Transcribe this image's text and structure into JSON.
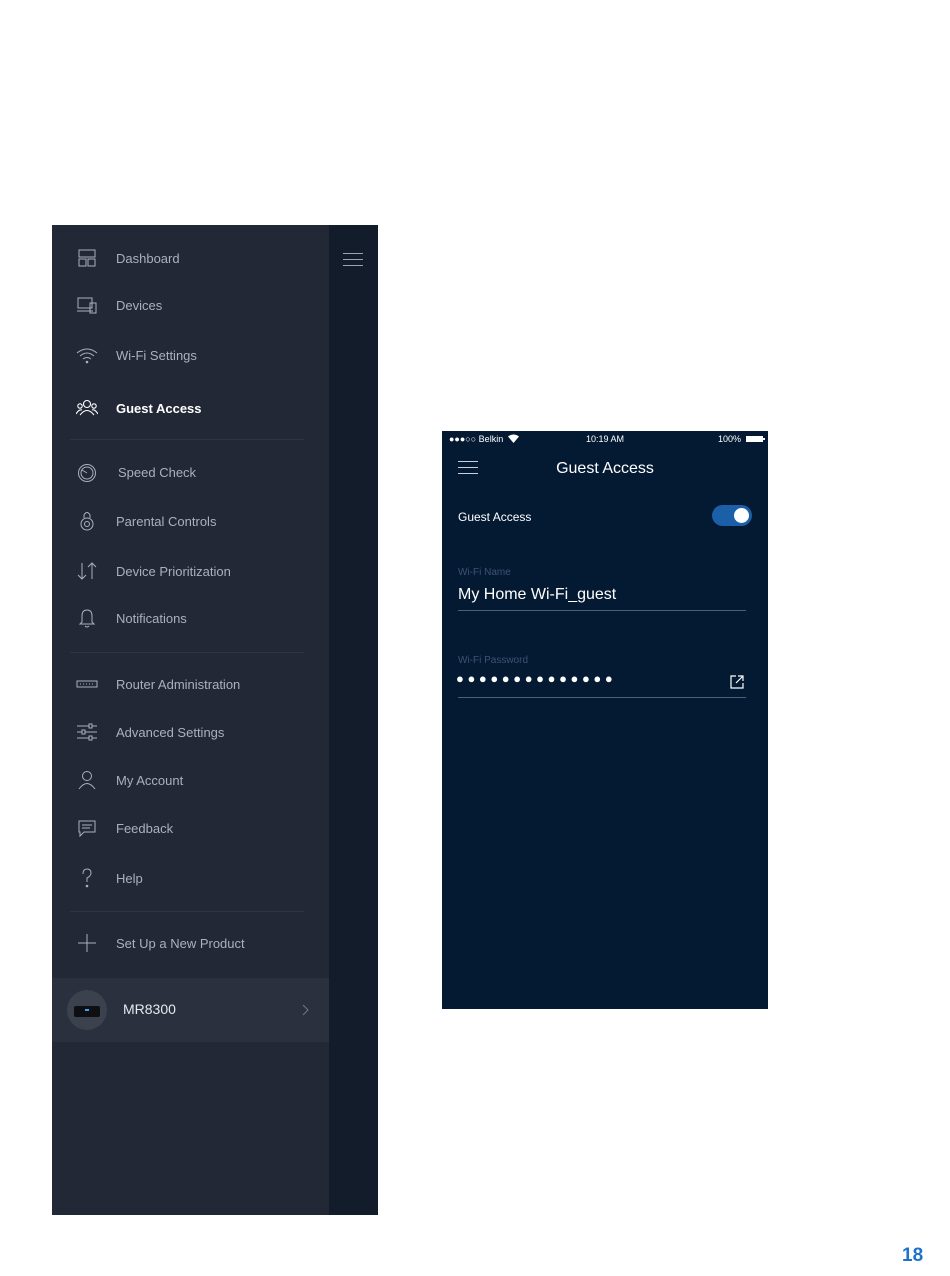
{
  "menu": {
    "items": [
      {
        "label": "Dashboard",
        "icon": "dashboard-icon"
      },
      {
        "label": "Devices",
        "icon": "devices-icon"
      },
      {
        "label": "Wi-Fi Settings",
        "icon": "wifi-icon"
      },
      {
        "label": "Guest Access",
        "icon": "guest-access-icon",
        "active": true
      },
      {
        "label": "Speed Check",
        "icon": "speedometer-icon"
      },
      {
        "label": "Parental Controls",
        "icon": "parental-controls-icon"
      },
      {
        "label": "Device Prioritization",
        "icon": "priority-arrows-icon"
      },
      {
        "label": "Notifications",
        "icon": "bell-icon"
      },
      {
        "label": "Router Administration",
        "icon": "router-icon"
      },
      {
        "label": "Advanced Settings",
        "icon": "sliders-icon"
      },
      {
        "label": "My Account",
        "icon": "user-icon"
      },
      {
        "label": "Feedback",
        "icon": "chat-bubble-icon"
      },
      {
        "label": "Help",
        "icon": "question-icon"
      },
      {
        "label": "Set Up a New Product",
        "icon": "plus-icon"
      }
    ],
    "device": {
      "name": "MR8300"
    }
  },
  "phone": {
    "status_bar": {
      "carrier": "●●●○○ Belkin",
      "time": "10:19 AM",
      "battery": "100%"
    },
    "title": "Guest Access",
    "guest_access": {
      "label": "Guest Access",
      "enabled": true
    },
    "wifi_name": {
      "label": "Wi-Fi Name",
      "value": "My Home Wi-Fi_guest"
    },
    "wifi_password": {
      "label": "Wi-Fi Password",
      "value": "●●●●●●●●●●●●●●"
    }
  },
  "page_number": "18",
  "colors": {
    "menu_bg": "#222835",
    "menu_strip": "#131c2b",
    "phone_bg": "#041a33",
    "toggle_on": "#1a5fa8",
    "page_number": "#1d73c9"
  }
}
